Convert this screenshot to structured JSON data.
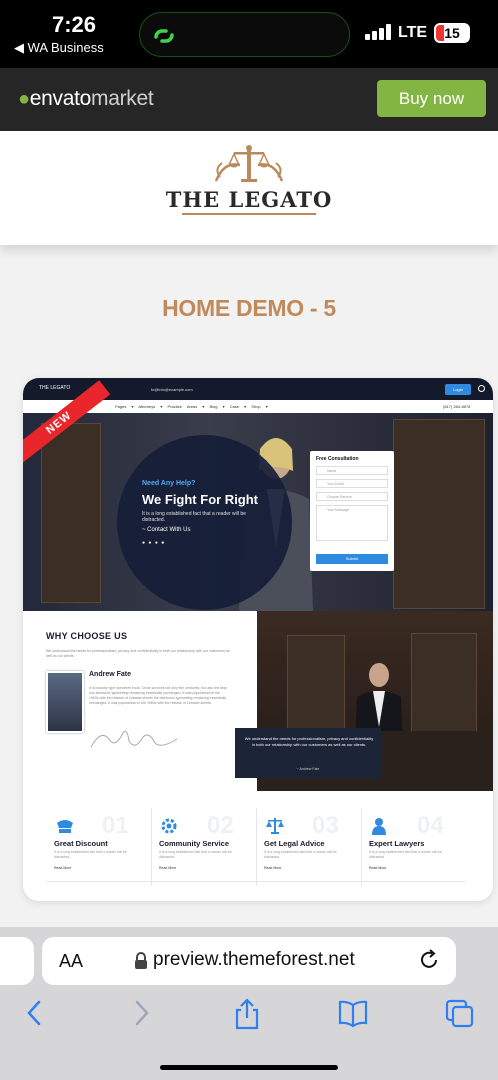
{
  "status_bar": {
    "time": "7:26",
    "back_label": "◀ WA Business",
    "network": "LTE",
    "battery": "15"
  },
  "envato": {
    "brand_main": "envato",
    "brand_sub": "market",
    "buy_label": "Buy now",
    "accent": "#82b541"
  },
  "logo": {
    "text": "THE LEGATO"
  },
  "demo_title": "HOME DEMO - 5",
  "preview": {
    "ribbon": "NEW",
    "topbar_email": "fo@info@example.com",
    "login": "Login",
    "nav_menu": "Pages ▾  Attorneys ▾  Practice Areas ▾  Blog ▾  Case ▾  Shop ▾",
    "phone": "(817) 284-5678",
    "hero": {
      "eyebrow": "Need Any Help?",
      "heading": "We Fight For Right",
      "text": "It is a long established fact that a reader will be distracted.",
      "cta": "~ Contact With Us",
      "dots": "● ● ● ●"
    },
    "form": {
      "title": "Free Consultation",
      "name": "Name",
      "email": "Your Email",
      "service": "Choose Service",
      "message": "Your Message",
      "submit": "Submit"
    },
    "why": {
      "heading": "WHY CHOOSE US",
      "text": "We understand the needs for professionalism, privacy and confidentiality in both our relationship with our customers as well as our clients.",
      "name": "Andrew Fate",
      "bio": "It is industry type specimen book. Close survives not only five centuries, but also the leap into electronic typesetting remaining essentially unchanged. It was popularised in the 1960s with the release of Letraset sheets the electronic typesetting remaining essentially unchanged. It was popularised in the 1960s with the release of Letraset sheets."
    },
    "quote": {
      "text": "We understand the needs for professionalism, privacy and confidentiality in both our relationship with our customers as well as our clients.",
      "by": "~ Andrew Fate"
    },
    "features": [
      {
        "num": "01",
        "title": "Great Discount",
        "text": "It is a long established fact that a reader will be distracted.",
        "more": "Read More"
      },
      {
        "num": "02",
        "title": "Community Service",
        "text": "It is a long established fact that a reader will be distracted.",
        "more": "Read More"
      },
      {
        "num": "03",
        "title": "Get Legal Advice",
        "text": "It is a long established fact that a reader will be distracted.",
        "more": "Read More"
      },
      {
        "num": "04",
        "title": "Expert Lawyers",
        "text": "It is a long established fact that a reader will be distracted.",
        "more": "Read More"
      }
    ]
  },
  "browser": {
    "aa": "AA",
    "url": "preview.themeforest.net"
  },
  "icons": [
    "back-icon",
    "forward-icon",
    "share-icon",
    "bookmarks-icon",
    "tabs-icon",
    "reload-icon",
    "lock-icon"
  ]
}
